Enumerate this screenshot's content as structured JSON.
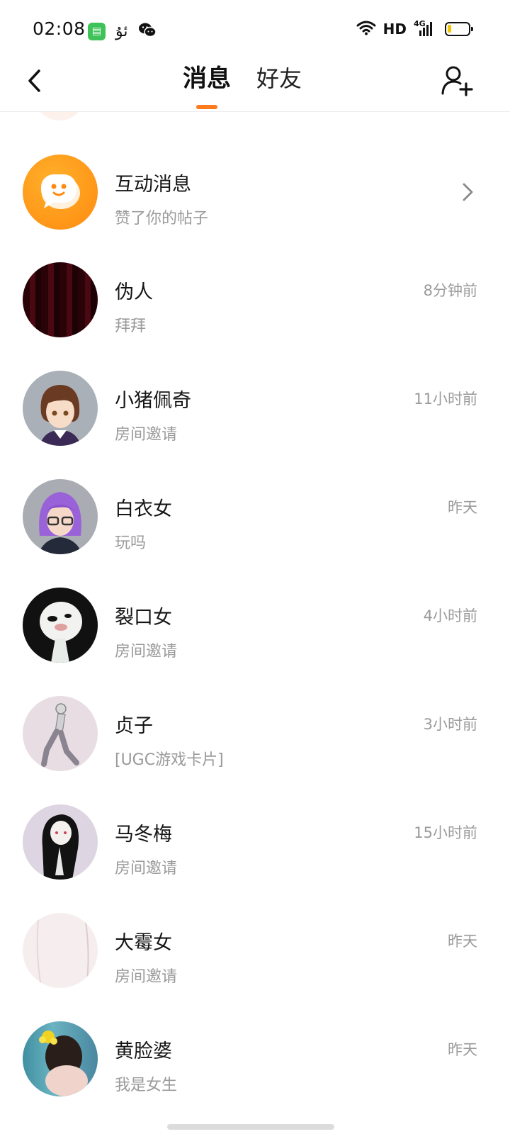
{
  "status_bar": {
    "time": "02:08",
    "icons": [
      "app-store-icon",
      "uyghur-glyph-icon",
      "wechat-icon"
    ],
    "network_hd": "HD",
    "network_4g": "4G",
    "battery_level": 0.2,
    "battery_color": "#f3c400"
  },
  "header": {
    "tabs": [
      {
        "label": "消息",
        "active": true
      },
      {
        "label": "好友",
        "active": false
      }
    ],
    "accent": "#ff7a1a"
  },
  "interaction": {
    "title": "互动消息",
    "subtitle": "赞了你的帖子"
  },
  "conversations": [
    {
      "name": "伪人",
      "message": "拜拜",
      "time": "8分钟前"
    },
    {
      "name": "小猪佩奇",
      "message": "房间邀请",
      "time": "11小时前"
    },
    {
      "name": "白衣女",
      "message": "玩吗",
      "time": "昨天"
    },
    {
      "name": "裂口女",
      "message": "房间邀请",
      "time": "4小时前"
    },
    {
      "name": "贞子",
      "message": "[UGC游戏卡片]",
      "time": "3小时前"
    },
    {
      "name": "马冬梅",
      "message": "房间邀请",
      "time": "15小时前"
    },
    {
      "name": "大霉女",
      "message": "房间邀请",
      "time": "昨天"
    },
    {
      "name": "黄脸婆",
      "message": "我是女生",
      "time": "昨天"
    }
  ]
}
